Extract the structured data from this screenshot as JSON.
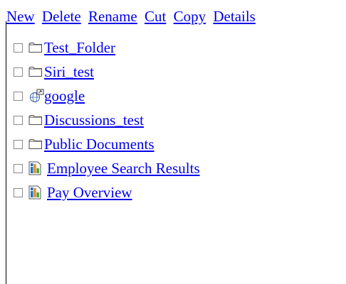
{
  "toolbar": {
    "new_label": "New",
    "delete_label": "Delete",
    "rename_label": "Rename",
    "cut_label": "Cut",
    "copy_label": "Copy",
    "details_label": "Details"
  },
  "items": [
    {
      "label": "Test_Folder",
      "icon": "folder-icon",
      "checked": false
    },
    {
      "label": "Siri_test",
      "icon": "folder-icon",
      "checked": false
    },
    {
      "label": " google",
      "icon": "web-link-icon",
      "checked": false
    },
    {
      "label": "Discussions_test",
      "icon": "folder-icon",
      "checked": false
    },
    {
      "label": "Public Documents",
      "icon": "folder-icon",
      "checked": false
    },
    {
      "label": "Employee Search Results",
      "icon": "report-icon",
      "checked": false
    },
    {
      "label": "Pay Overview",
      "icon": "report-icon",
      "checked": false
    }
  ],
  "colors": {
    "link": "#0000ee",
    "report_blue": "#1f6fd1",
    "report_orange": "#f08a1c",
    "report_green": "#3aa935"
  }
}
